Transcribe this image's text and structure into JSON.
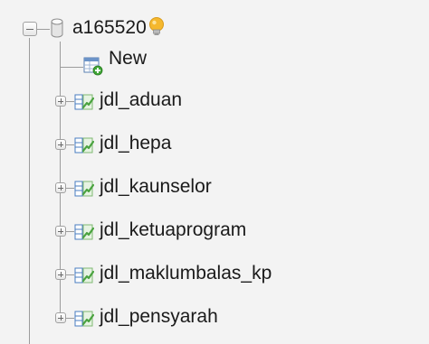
{
  "database": {
    "name": "a165520",
    "icon": "database-cylinder-icon",
    "hint_icon": "lightbulb-icon",
    "expanded": true
  },
  "new_item": {
    "label": "New",
    "icon": "new-table-icon"
  },
  "tables": [
    {
      "name": "jdl_aduan",
      "icon": "table-icon",
      "expanded": false
    },
    {
      "name": "jdl_hepa",
      "icon": "table-icon",
      "expanded": false
    },
    {
      "name": "jdl_kaunselor",
      "icon": "table-icon",
      "expanded": false
    },
    {
      "name": "jdl_ketuaprogram",
      "icon": "table-icon",
      "expanded": false
    },
    {
      "name": "jdl_maklumbalas_kp",
      "icon": "table-icon",
      "expanded": false
    },
    {
      "name": "jdl_pensyarah",
      "icon": "table-icon",
      "expanded": false
    }
  ],
  "colors": {
    "background": "#f3f3f3",
    "tree_line": "#9c9c9c",
    "bulb": "#f5b82e",
    "table_green": "#4aa33f",
    "table_blue": "#3c78c8"
  }
}
